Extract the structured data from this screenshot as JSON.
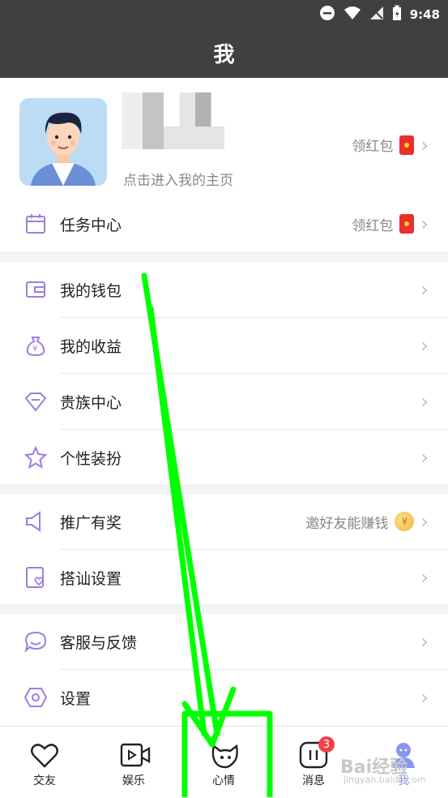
{
  "status": {
    "time": "9:48"
  },
  "header": {
    "title": "我"
  },
  "profile": {
    "hint": "点击进入我的主页",
    "reward_label": "领红包"
  },
  "task_row": {
    "label": "任务中心",
    "reward_label": "领红包"
  },
  "group1": [
    {
      "label": "我的钱包"
    },
    {
      "label": "我的收益"
    },
    {
      "label": "贵族中心"
    },
    {
      "label": "个性装扮"
    }
  ],
  "group2": {
    "promo": {
      "label": "推广有奖",
      "hint": "邀好友能赚钱"
    },
    "chat": {
      "label": "搭讪设置"
    }
  },
  "group3": [
    {
      "label": "客服与反馈"
    },
    {
      "label": "设置"
    }
  ],
  "tabs": [
    {
      "label": "交友"
    },
    {
      "label": "娱乐"
    },
    {
      "label": "心情"
    },
    {
      "label": "消息",
      "badge": "3"
    },
    {
      "label": "我"
    }
  ],
  "watermark": {
    "line1": "Bai经验",
    "line2": "jingyan.baidu.com"
  },
  "colors": {
    "accent_icon": "#9b7fe0",
    "header_bg": "#404040",
    "annotation": "#00ff00"
  }
}
